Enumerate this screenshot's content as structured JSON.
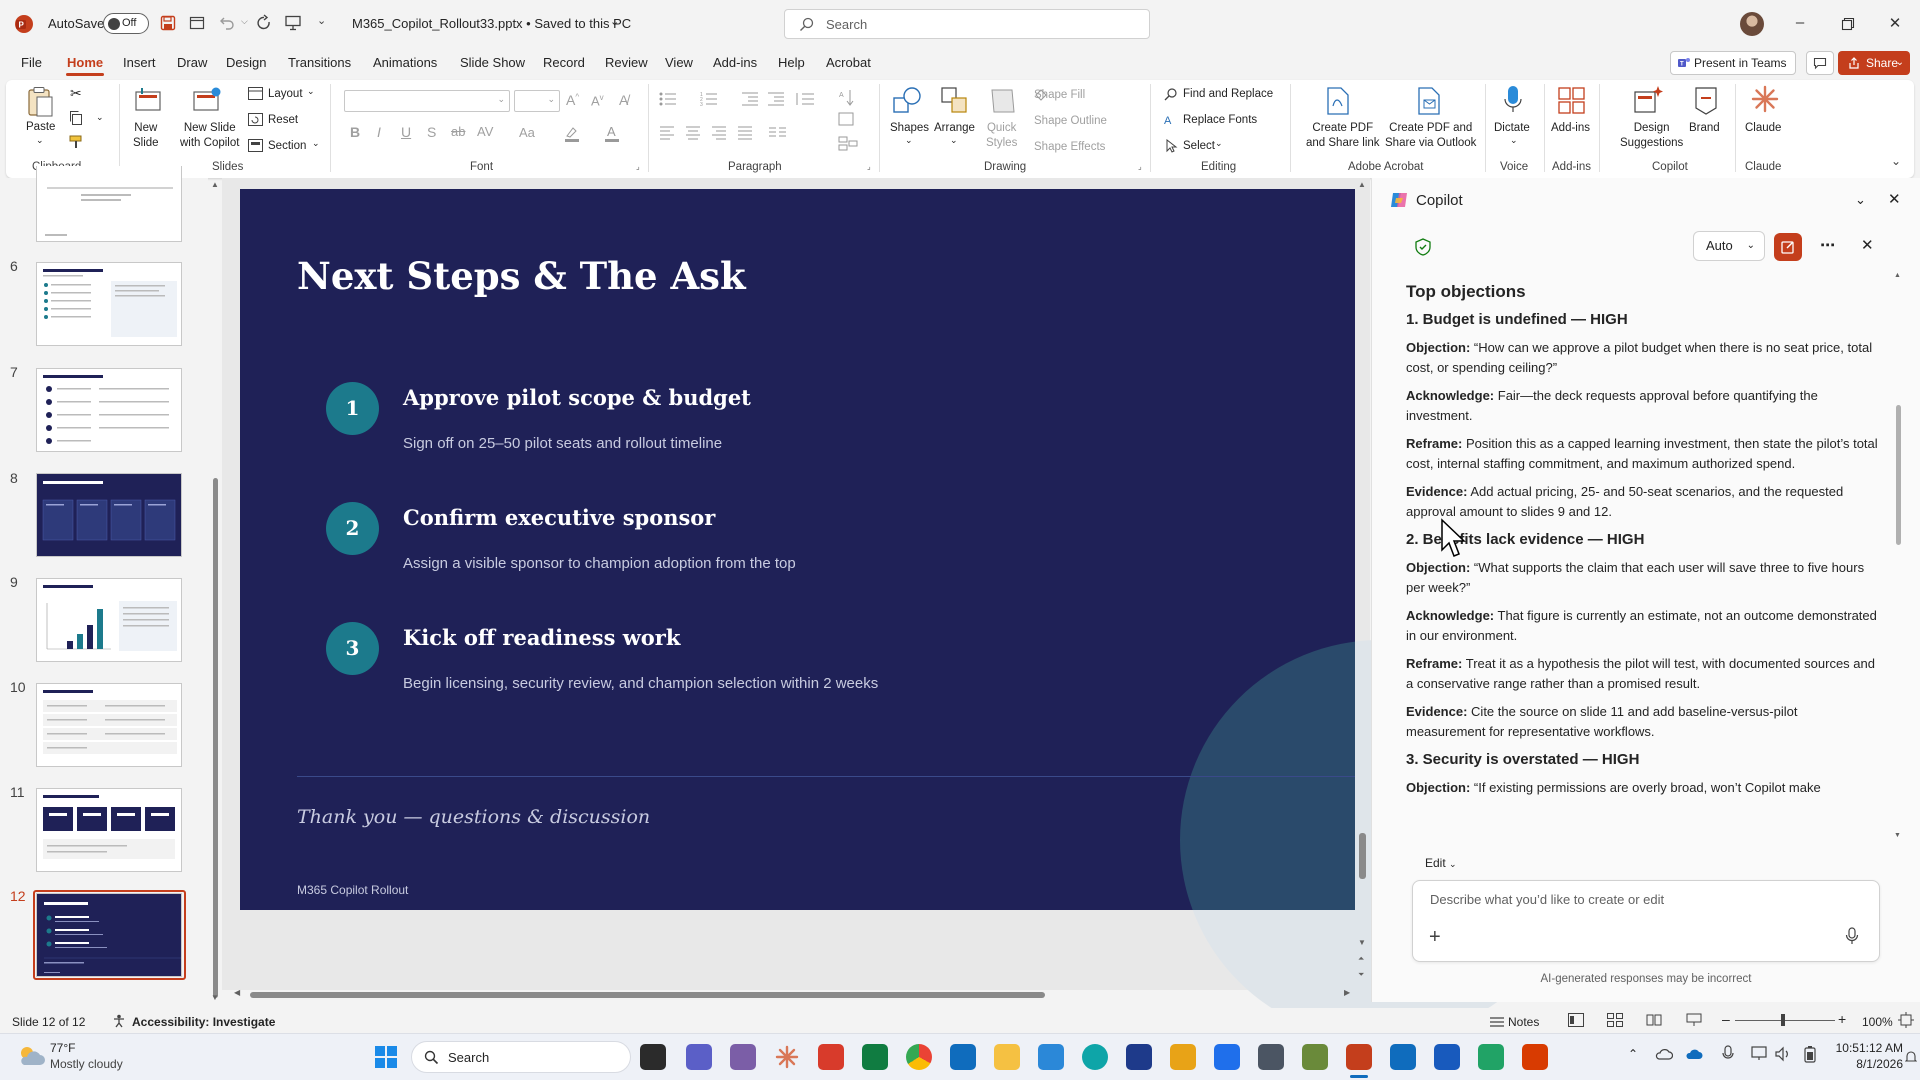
{
  "titlebar": {
    "autosave_label": "AutoSave",
    "autosave_state": "Off",
    "doc_title": "M365_Copilot_Rollout33.pptx • Saved to this PC",
    "search_placeholder": "Search"
  },
  "menu": {
    "tabs": [
      "File",
      "Home",
      "Insert",
      "Draw",
      "Design",
      "Transitions",
      "Animations",
      "Slide Show",
      "Record",
      "Review",
      "View",
      "Add-ins",
      "Help",
      "Acrobat"
    ],
    "active_tab": "Home",
    "present_in_teams": "Present in Teams",
    "share": "Share"
  },
  "ribbon": {
    "clipboard": {
      "paste": "Paste",
      "label": "Clipboard"
    },
    "slides": {
      "new_slide": "New\nSlide",
      "new_slide_copilot": "New Slide\nwith Copilot",
      "layout": "Layout",
      "reset": "Reset",
      "section": "Section",
      "label": "Slides"
    },
    "font": {
      "label": "Font"
    },
    "paragraph": {
      "label": "Paragraph"
    },
    "drawing": {
      "shapes": "Shapes",
      "arrange": "Arrange",
      "quick_styles": "Quick\nStyles",
      "shape_fill": "Shape Fill",
      "shape_outline": "Shape Outline",
      "shape_effects": "Shape Effects",
      "label": "Drawing"
    },
    "editing": {
      "find_replace": "Find and Replace",
      "replace_fonts": "Replace Fonts",
      "select": "Select",
      "label": "Editing"
    },
    "acrobat": {
      "create_pdf_share_link": "Create PDF\nand Share link",
      "create_pdf_outlook": "Create PDF and\nShare via Outlook",
      "label": "Adobe Acrobat"
    },
    "voice": {
      "dictate": "Dictate",
      "label": "Voice"
    },
    "addins": {
      "addins": "Add-ins",
      "label": "Add-ins"
    },
    "copilot": {
      "design_suggestions": "Design\nSuggestions",
      "label": "Copilot"
    },
    "brand": {
      "brand": "Brand"
    },
    "claude": {
      "claude": "Claude",
      "label": "Claude"
    }
  },
  "thumbnails": {
    "numbers": [
      "6",
      "7",
      "8",
      "9",
      "10",
      "11",
      "12"
    ],
    "active": "12"
  },
  "slide": {
    "title": "Next Steps & The Ask",
    "steps": [
      {
        "num": "1",
        "title": "Approve pilot scope & budget",
        "desc": "Sign off on 25–50 pilot seats and rollout timeline"
      },
      {
        "num": "2",
        "title": "Confirm executive sponsor",
        "desc": "Assign a visible sponsor to champion adoption from the top"
      },
      {
        "num": "3",
        "title": "Kick off readiness work",
        "desc": "Begin licensing, security review, and champion selection within 2 weeks"
      }
    ],
    "thanks": "Thank you — questions & discussion",
    "footer": "M365 Copilot Rollout"
  },
  "copilot": {
    "title": "Copilot",
    "mode": "Auto",
    "heading": "Top objections",
    "objections": [
      {
        "title": "1. Budget is undefined — HIGH",
        "objection": "“How can we approve a pilot budget when there is no seat price, total cost, or spending ceiling?”",
        "acknowledge": "Fair—the deck requests approval before quantifying the investment.",
        "reframe": "Position this as a capped learning investment, then state the pilot’s total cost, internal staffing commitment, and maximum authorized spend.",
        "evidence": "Add actual pricing, 25- and 50-seat scenarios, and the requested approval amount to slides 9 and 12."
      },
      {
        "title": "2. Benefits lack evidence — HIGH",
        "objection": "“What supports the claim that each user will save three to five hours per week?”",
        "acknowledge": "That figure is currently an estimate, not an outcome demonstrated in our environment.",
        "reframe": "Treat it as a hypothesis the pilot will test, with documented sources and a conservative range rather than a promised result.",
        "evidence": "Cite the source on slide 11 and add baseline-versus-pilot measurement for representative workflows."
      },
      {
        "title": "3. Security is overstated — HIGH",
        "objection": "“If existing permissions are overly broad, won’t Copilot make"
      }
    ],
    "labels": {
      "objection": "Objection:",
      "acknowledge": "Acknowledge:",
      "reframe": "Reframe:",
      "evidence": "Evidence:"
    },
    "edit_label": "Edit",
    "input_placeholder": "Describe what you’d like to create or edit",
    "disclaimer": "AI-generated responses may be incorrect"
  },
  "status": {
    "slide_of": "Slide 12 of 12",
    "accessibility": "Accessibility: Investigate",
    "notes": "Notes",
    "zoom": "100%"
  },
  "taskbar": {
    "weather_temp": "77°F",
    "weather_desc": "Mostly cloudy",
    "search": "Search",
    "time": "10:51:12 AM",
    "date": "8/1/2026"
  },
  "colors": {
    "accent": "#c43e1c",
    "slide_bg": "#1f2157",
    "step_circle": "#1c7a8c"
  }
}
